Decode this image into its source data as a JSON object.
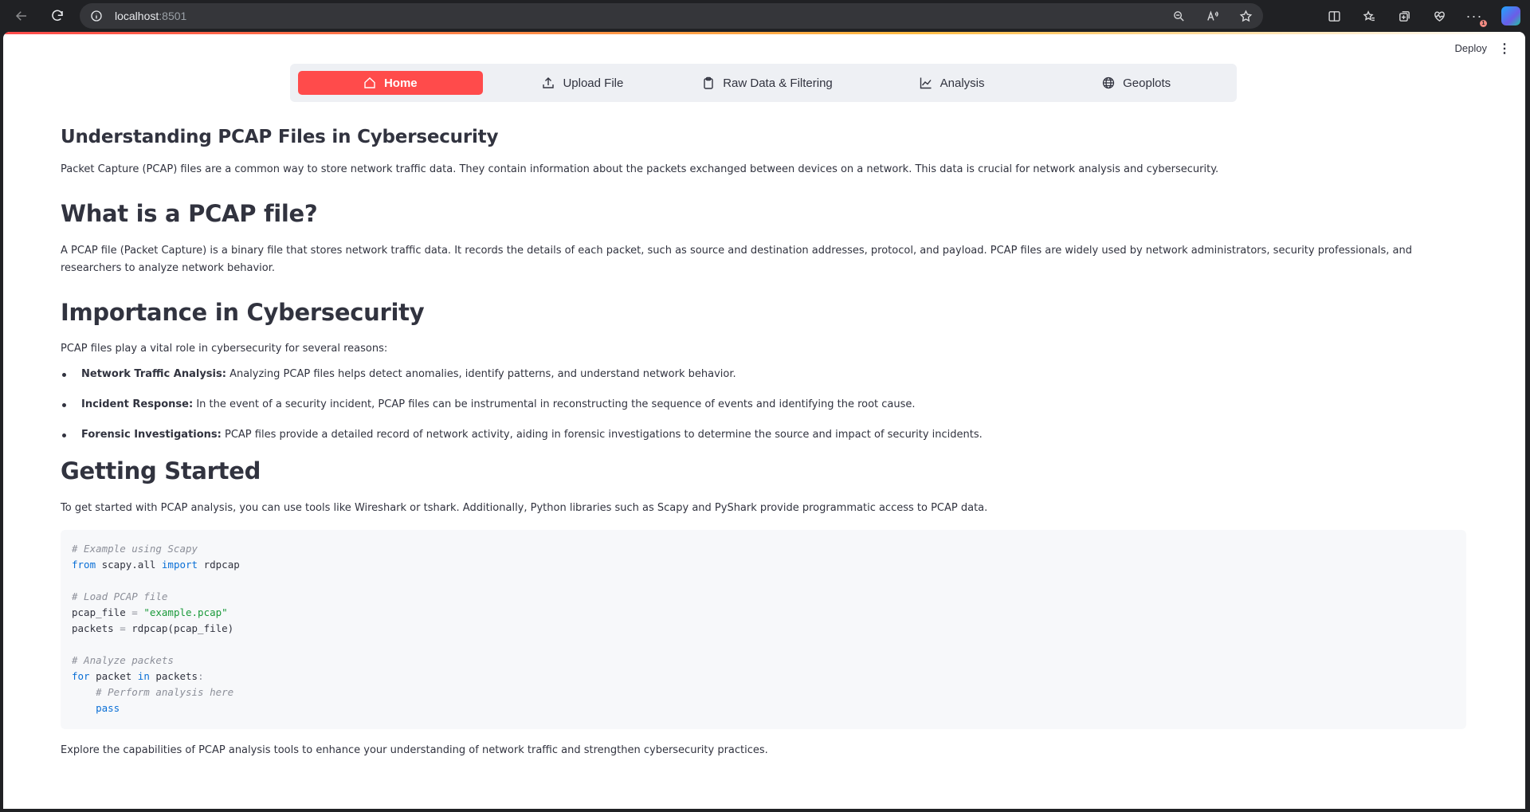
{
  "browser": {
    "url_host": "localhost",
    "url_port": ":8501",
    "notification_count": "1"
  },
  "app": {
    "deploy_label": "Deploy",
    "menu": [
      {
        "label": "Home",
        "icon": "house-icon",
        "active": true
      },
      {
        "label": "Upload File",
        "icon": "upload-icon",
        "active": false
      },
      {
        "label": "Raw Data & Filtering",
        "icon": "clipboard-icon",
        "active": false
      },
      {
        "label": "Analysis",
        "icon": "graph-up-icon",
        "active": false
      },
      {
        "label": "Geoplots",
        "icon": "globe-icon",
        "active": false
      }
    ],
    "accent_color": "#ff4b4b"
  },
  "content": {
    "h1": "Understanding PCAP Files in Cybersecurity",
    "p1": "Packet Capture (PCAP) files are a common way to store network traffic data. They contain information about the packets exchanged between devices on a network. This data is crucial for network analysis and cybersecurity.",
    "h2": "What is a PCAP file?",
    "p2": "A PCAP file (Packet Capture) is a binary file that stores network traffic data. It records the details of each packet, such as source and destination addresses, protocol, and payload. PCAP files are widely used by network administrators, security professionals, and researchers to analyze network behavior.",
    "h3": "Importance in Cybersecurity",
    "p3": "PCAP files play a vital role in cybersecurity for several reasons:",
    "bullets": [
      {
        "bold": "Network Traffic Analysis:",
        "text": " Analyzing PCAP files helps detect anomalies, identify patterns, and understand network behavior."
      },
      {
        "bold": "Incident Response:",
        "text": " In the event of a security incident, PCAP files can be instrumental in reconstructing the sequence of events and identifying the root cause."
      },
      {
        "bold": "Forensic Investigations:",
        "text": " PCAP files provide a detailed record of network activity, aiding in forensic investigations to determine the source and impact of security incidents."
      }
    ],
    "h4": "Getting Started",
    "p4": "To get started with PCAP analysis, you can use tools like Wireshark or tshark. Additionally, Python libraries such as Scapy and PyShark provide programmatic access to PCAP data.",
    "code": {
      "comment1": "# Example using Scapy",
      "kw_from": "from",
      "module": " scapy.all ",
      "kw_import": "import",
      "import_name": " rdpcap",
      "comment2": "# Load PCAP file",
      "var1": "pcap_file ",
      "eq": "=",
      "str1": " \"example.pcap\"",
      "var2": "packets ",
      "call": " rdpcap(pcap_file)",
      "comment3": "# Analyze packets",
      "kw_for": "for",
      "loop_var": " packet ",
      "kw_in": "in",
      "loop_iter": " packets",
      "colon": ":",
      "comment4": "    # Perform analysis here",
      "indent": "    ",
      "kw_pass": "pass"
    },
    "p5": "Explore the capabilities of PCAP analysis tools to enhance your understanding of network traffic and strengthen cybersecurity practices."
  }
}
